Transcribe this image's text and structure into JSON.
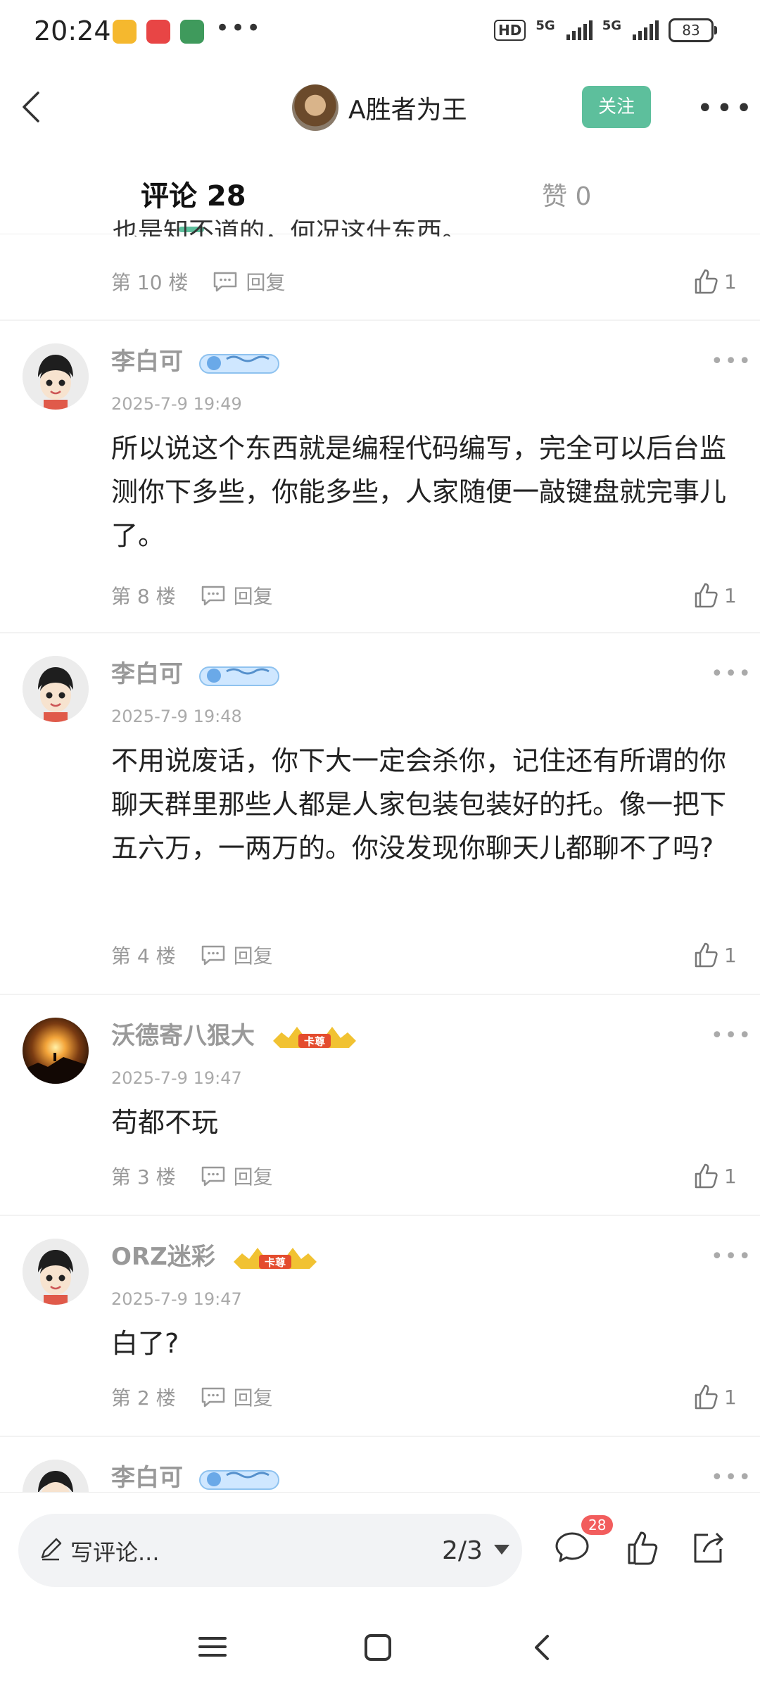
{
  "status_bar": {
    "time": "20:24",
    "dots": "•••",
    "hd_label": "HD",
    "sig1_label": "5G",
    "sig2_label": "5G",
    "battery": "83"
  },
  "header": {
    "user_name": "A胜者为王",
    "follow_label": "关注"
  },
  "tabs": {
    "comments_label": "评论 28",
    "likes_label": "赞 0"
  },
  "partial_comment": {
    "text": "也是知不道的，何况这什东西。",
    "floor": "第 10 楼",
    "reply_label": "回复",
    "likes": "1"
  },
  "comments": [
    {
      "name": "李白可",
      "time": "2025-7-9 19:49",
      "text": "所以说这个东西就是编程代码编写，完全可以后台监测你下多些，你能多些，人家随便一敲键盘就完事儿了。",
      "floor": "第 8 楼",
      "reply_label": "回复",
      "likes": "1"
    },
    {
      "name": "李白可",
      "time": "2025-7-9 19:48",
      "text": "不用说废话，你下大一定会杀你，记住还有所谓的你聊天群里那些人都是人家包装包装好的托。像一把下五六万，一两万的。你没发现你聊天儿都聊不了吗?",
      "floor": "第 4 楼",
      "reply_label": "回复",
      "likes": "1"
    },
    {
      "name": "沃德寄八狠大",
      "badge": "卡尊",
      "time": "2025-7-9 19:47",
      "text": "苟都不玩",
      "floor": "第 3 楼",
      "reply_label": "回复",
      "likes": "1"
    },
    {
      "name": "ORZ迷彩",
      "badge": "卡尊",
      "time": "2025-7-9 19:47",
      "text": "白了?",
      "floor": "第 2 楼",
      "reply_label": "回复",
      "likes": "1"
    },
    {
      "name": "李白可"
    }
  ],
  "bottom_bar": {
    "write_placeholder": "写评论...",
    "page_indicator": "2/3",
    "comment_badge": "28"
  },
  "colors": {
    "accent": "#5dbf9c",
    "badge_red": "#f25d5d",
    "muted": "#999999"
  },
  "icons": [
    "back-icon",
    "more-icon",
    "reply-icon",
    "thumb-icon",
    "pen-icon",
    "comment-icon",
    "share-icon",
    "menu-icon",
    "home-icon"
  ]
}
